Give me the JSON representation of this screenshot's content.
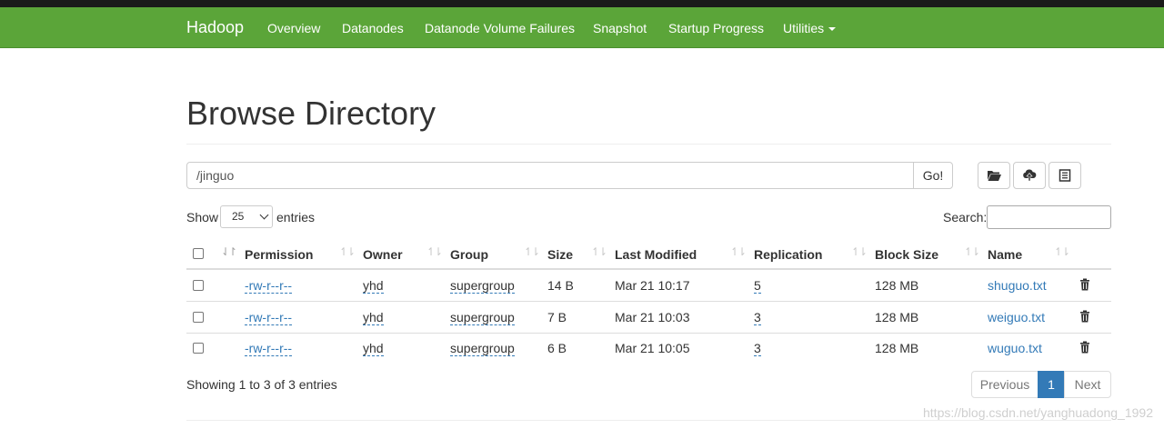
{
  "navbar": {
    "brand": "Hadoop",
    "items": [
      {
        "label": "Overview"
      },
      {
        "label": "Datanodes"
      },
      {
        "label": "Datanode Volume Failures"
      },
      {
        "label": "Snapshot"
      },
      {
        "label": "Startup Progress"
      },
      {
        "label": "Utilities"
      }
    ],
    "color": "#5ba539"
  },
  "page": {
    "title": "Browse Directory",
    "path_value": "/jinguo",
    "go_label": "Go!",
    "icons": [
      "folder-open-icon",
      "upload-cloud-icon",
      "list-alt-icon"
    ]
  },
  "table_controls": {
    "show_label": "Show",
    "page_size": "25",
    "entries_label": "entries",
    "search_label": "Search:",
    "search_value": ""
  },
  "table": {
    "columns": [
      "Permission",
      "Owner",
      "Group",
      "Size",
      "Last Modified",
      "Replication",
      "Block Size",
      "Name"
    ],
    "rows": [
      {
        "permission": "-rw-r--r--",
        "owner": "yhd",
        "group": "supergroup",
        "size": "14 B",
        "last_modified": "Mar 21 10:17",
        "replication": "5",
        "block_size": "128 MB",
        "name": "shuguo.txt"
      },
      {
        "permission": "-rw-r--r--",
        "owner": "yhd",
        "group": "supergroup",
        "size": "7 B",
        "last_modified": "Mar 21 10:03",
        "replication": "3",
        "block_size": "128 MB",
        "name": "weiguo.txt"
      },
      {
        "permission": "-rw-r--r--",
        "owner": "yhd",
        "group": "supergroup",
        "size": "6 B",
        "last_modified": "Mar 21 10:05",
        "replication": "3",
        "block_size": "128 MB",
        "name": "wuguo.txt"
      }
    ]
  },
  "footer": {
    "info": "Showing 1 to 3 of 3 entries",
    "previous": "Previous",
    "current_page": "1",
    "next": "Next",
    "watermark": "https://blog.csdn.net/yanghuadong_1992"
  },
  "colors": {
    "link": "#337ab7",
    "active_page": "#337ab7"
  }
}
